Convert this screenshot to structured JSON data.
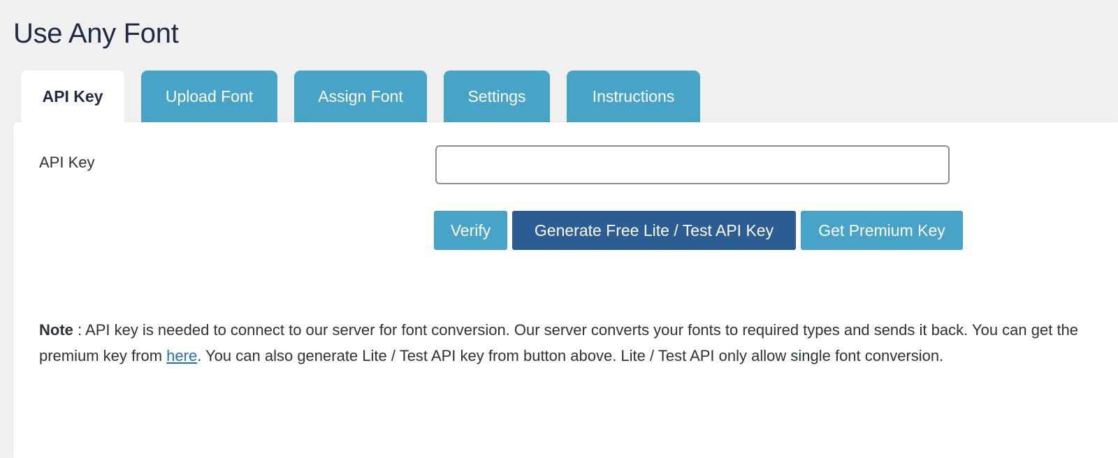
{
  "page": {
    "title": "Use Any Font"
  },
  "tabs": [
    {
      "label": "API Key",
      "active": true
    },
    {
      "label": "Upload Font",
      "active": false
    },
    {
      "label": "Assign Font",
      "active": false
    },
    {
      "label": "Settings",
      "active": false
    },
    {
      "label": "Instructions",
      "active": false
    }
  ],
  "form": {
    "api_key_label": "API Key",
    "api_key_value": "",
    "api_key_placeholder": ""
  },
  "buttons": {
    "verify": "Verify",
    "generate": "Generate Free Lite / Test API Key",
    "premium": "Get Premium Key"
  },
  "note": {
    "label": "Note",
    "separator": " : ",
    "text_before_link": "API key is needed to connect to our server for font conversion. Our server converts your fonts to required types and sends it back. You can get the premium key from ",
    "link_text": "here",
    "text_after_link": ". You can also generate Lite / Test API key from button above. Lite / Test API only allow single font conversion."
  },
  "colors": {
    "tab_inactive": "#47a4c7",
    "button_light": "#47a4c7",
    "button_dark": "#2b5d92",
    "title": "#1d2b45",
    "link": "#2271b1",
    "background": "#f0f0f1"
  }
}
